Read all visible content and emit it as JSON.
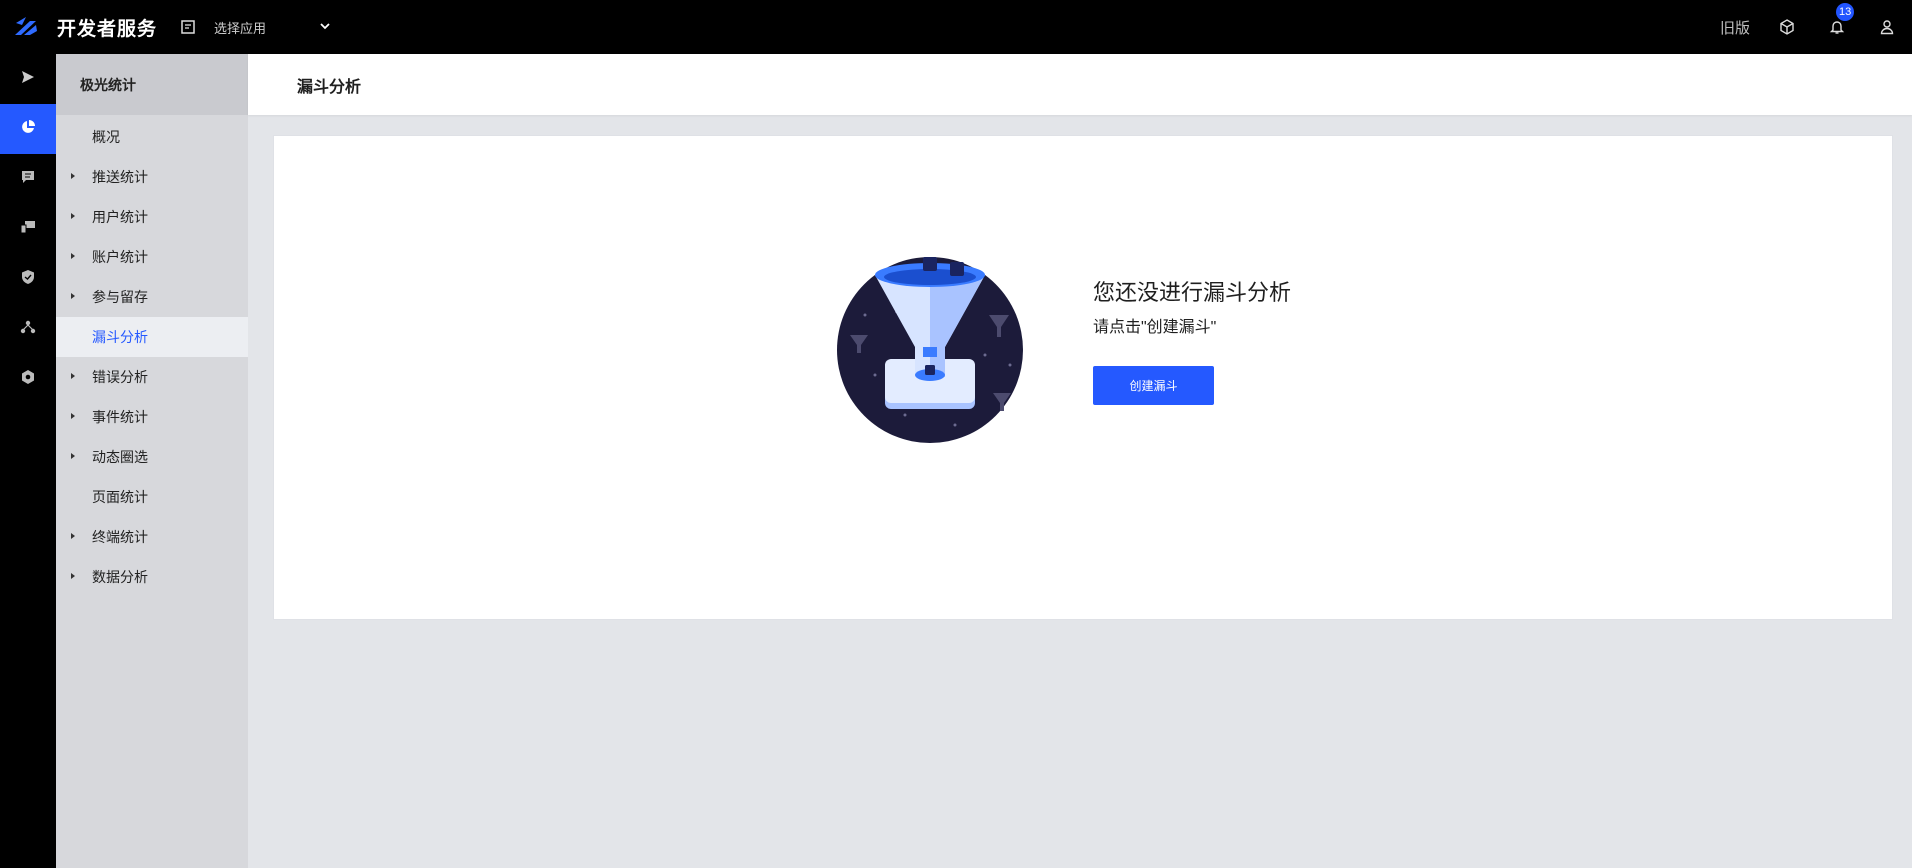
{
  "header": {
    "brand": "开发者服务",
    "app_select_placeholder": "选择应用",
    "old_version": "旧版",
    "notification_count": "13"
  },
  "rail": {
    "items": [
      {
        "icon": "send-icon"
      },
      {
        "icon": "chart-pie-icon",
        "active": true
      },
      {
        "icon": "message-icon"
      },
      {
        "icon": "devices-icon"
      },
      {
        "icon": "shield-icon"
      },
      {
        "icon": "network-icon"
      },
      {
        "icon": "gear-icon"
      }
    ]
  },
  "sidebar": {
    "title": "极光统计",
    "items": [
      {
        "label": "概况",
        "expandable": false
      },
      {
        "label": "推送统计",
        "expandable": true
      },
      {
        "label": "用户统计",
        "expandable": true
      },
      {
        "label": "账户统计",
        "expandable": true
      },
      {
        "label": "参与留存",
        "expandable": true
      },
      {
        "label": "漏斗分析",
        "expandable": false,
        "active": true
      },
      {
        "label": "错误分析",
        "expandable": true
      },
      {
        "label": "事件统计",
        "expandable": true
      },
      {
        "label": "动态圈选",
        "expandable": true
      },
      {
        "label": "页面统计",
        "expandable": false
      },
      {
        "label": "终端统计",
        "expandable": true
      },
      {
        "label": "数据分析",
        "expandable": true
      }
    ]
  },
  "page": {
    "title": "漏斗分析"
  },
  "empty_state": {
    "title": "您还没进行漏斗分析",
    "subtitle": "请点击\"创建漏斗\"",
    "button_label": "创建漏斗"
  },
  "colors": {
    "accent": "#2559ff",
    "topbar": "#000000",
    "sidebar": "#d7d8dc",
    "background": "#e3e5e9"
  }
}
